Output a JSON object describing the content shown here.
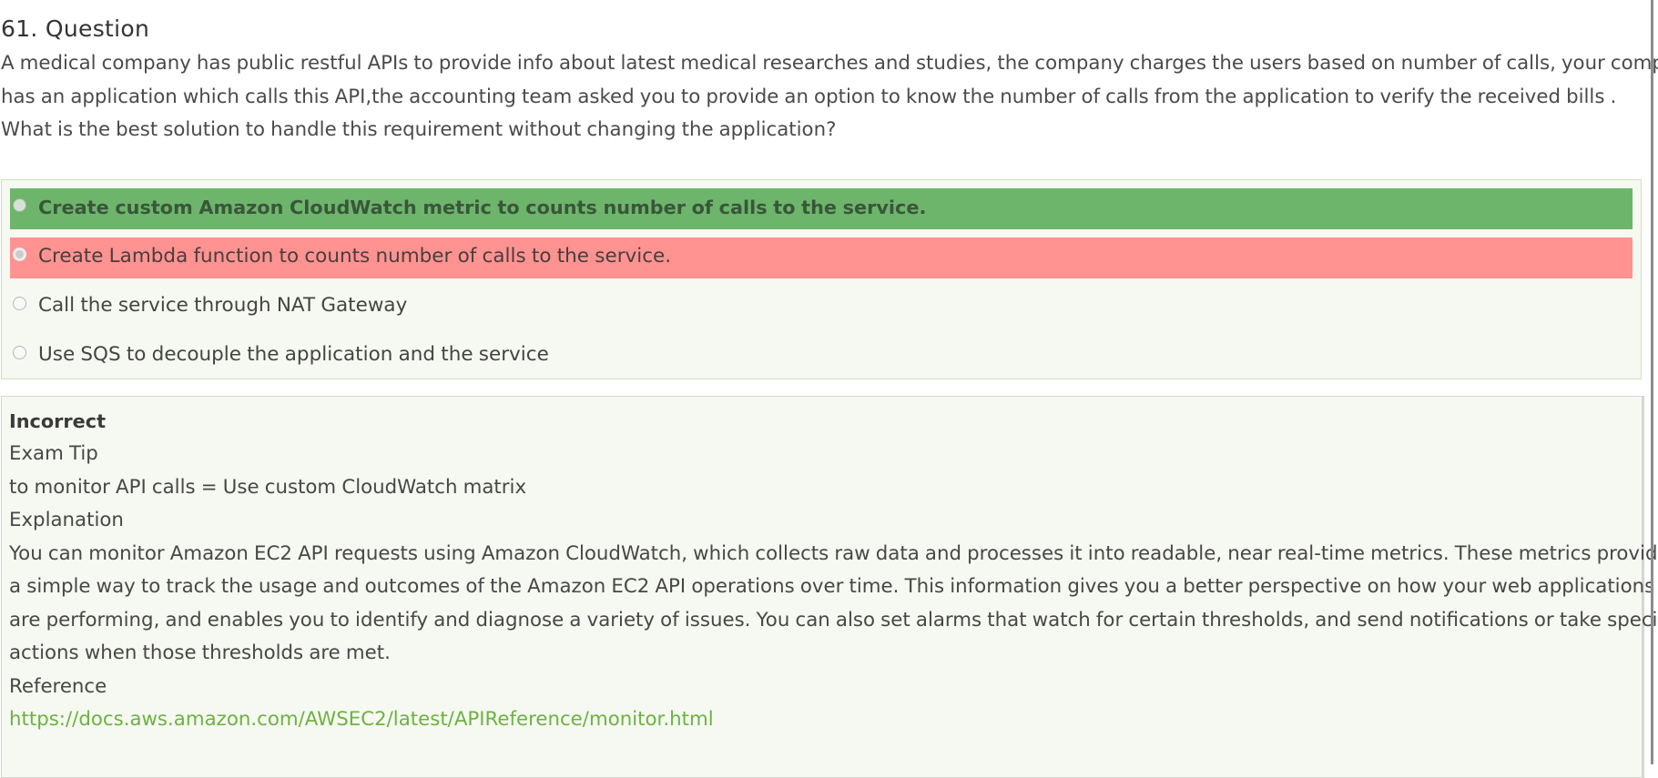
{
  "question": {
    "title": "61. Question",
    "lines": [
      "A medical company has public restful APIs to provide info about latest medical researches and studies, the company charges the users based on number of calls, your company",
      "has an application which calls this API,the accounting team asked you to provide an option to know the number of calls from the application to verify the received bills .",
      "What is the best solution to handle this requirement without changing the application?"
    ]
  },
  "options": [
    {
      "label": "Create custom Amazon CloudWatch metric to counts number of calls to the service.",
      "state": "correct"
    },
    {
      "label": "Create Lambda function to counts number of calls to the service.",
      "state": "selected-wrong"
    },
    {
      "label": "Call the service through NAT Gateway",
      "state": "none"
    },
    {
      "label": "Use SQS to decouple the application and the service",
      "state": "none"
    }
  ],
  "feedback": {
    "status": "Incorrect",
    "exam_tip_heading": "Exam Tip",
    "exam_tip_text": "to monitor API calls = Use custom CloudWatch matrix",
    "explanation_heading": "Explanation",
    "explanation_lines": [
      "You can monitor Amazon EC2 API requests using Amazon CloudWatch, which collects raw data and processes it into readable, near real-time metrics. These metrics provide",
      "a simple way to track the usage and outcomes of the Amazon EC2 API operations over time. This information gives you a better perspective on how your web applications",
      "are performing, and enables you to identify and diagnose a variety of issues. You can also set alarms that watch for certain thresholds, and send notifications or take specific",
      "actions when those thresholds are met."
    ],
    "reference_heading": "Reference",
    "reference_link": "https://docs.aws.amazon.com/AWSEC2/latest/APIReference/monitor.html"
  },
  "colors": {
    "correct_bg": "#6db56b",
    "wrong_bg": "#ff9391",
    "panel_bg": "#f6f8f2",
    "link": "#6cb33f"
  }
}
